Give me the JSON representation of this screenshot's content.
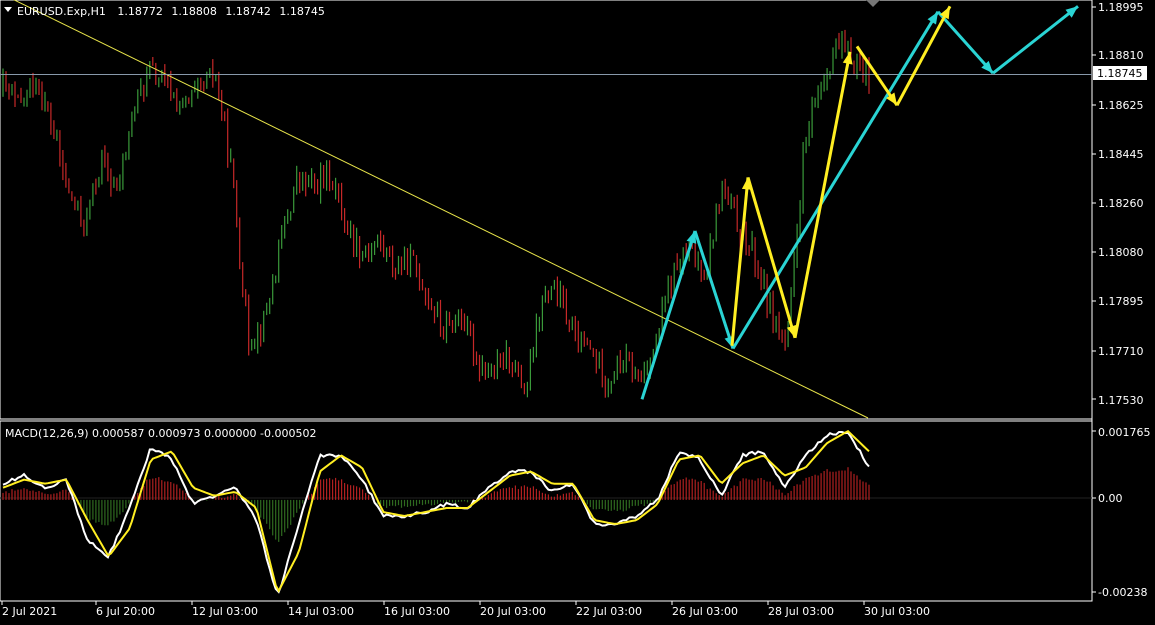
{
  "header": {
    "symbol_line": "EURUSD.Exp,H1",
    "ohlc": [
      "1.18772",
      "1.18808",
      "1.18742",
      "1.18745"
    ]
  },
  "price_axis": {
    "ticks": [
      "1.18995",
      "1.18810",
      "1.18625",
      "1.18445",
      "1.18260",
      "1.18080",
      "1.17895",
      "1.17710",
      "1.17530"
    ],
    "current_price": "1.18745"
  },
  "macd": {
    "title": "MACD(12,26,9) 0.000587 0.000973 0.000000 -0.000502",
    "ticks": [
      "0.001765",
      "0.00",
      "-0.00238"
    ]
  },
  "time_axis": {
    "ticks": [
      "2 Jul 2021",
      "6 Jul 20:00",
      "12 Jul 03:00",
      "14 Jul 03:00",
      "16 Jul 03:00",
      "20 Jul 03:00",
      "22 Jul 03:00",
      "26 Jul 03:00",
      "28 Jul 03:00",
      "30 Jul 03:00"
    ]
  },
  "colors": {
    "background": "#000000",
    "bull_candle": "#3a9a3a",
    "bear_candle": "#c62828",
    "trendline": "#e8e44a",
    "yellow_arrows": "#ffee22",
    "cyan_arrows": "#2ad4d4",
    "macd_line": "#ffffff",
    "signal_line": "#ffee22",
    "hist_positive": "#b02020",
    "hist_negative": "#2f6a1f",
    "current_price_line": "#8899aa"
  },
  "chart_data": [
    {
      "type": "candlestick",
      "symbol": "EURUSD.Exp",
      "timeframe": "H1",
      "ylim": [
        1.1746,
        1.1902
      ],
      "x_ticks": [
        "2 Jul 2021",
        "6 Jul 20:00",
        "12 Jul 03:00",
        "14 Jul 03:00",
        "16 Jul 03:00",
        "20 Jul 03:00",
        "22 Jul 03:00",
        "26 Jul 03:00",
        "28 Jul 03:00",
        "30 Jul 03:00"
      ],
      "close_path": [
        1.187,
        1.1862,
        1.1873,
        1.1855,
        1.183,
        1.1818,
        1.1842,
        1.183,
        1.1862,
        1.1876,
        1.187,
        1.1862,
        1.1868,
        1.1875,
        1.1838,
        1.1775,
        1.1782,
        1.1812,
        1.1835,
        1.1832,
        1.1838,
        1.1818,
        1.1808,
        1.1812,
        1.1802,
        1.1805,
        1.1792,
        1.1778,
        1.1785,
        1.1768,
        1.1762,
        1.177,
        1.1755,
        1.179,
        1.1793,
        1.1775,
        1.1771,
        1.176,
        1.1768,
        1.176,
        1.1775,
        1.18,
        1.1808,
        1.1801,
        1.1832,
        1.1818,
        1.1806,
        1.1786,
        1.1772,
        1.1845,
        1.187,
        1.1885,
        1.188,
        1.1875
      ],
      "trendline": [
        [
          0,
          1.1905
        ],
        [
          868,
          1.1746
        ]
      ],
      "current_price": 1.18745,
      "arrows_yellow": [
        [
          [
            732,
            1.1773
          ],
          [
            748,
            1.1836
          ]
        ],
        [
          [
            748,
            1.1836
          ],
          [
            795,
            1.1776
          ]
        ],
        [
          [
            795,
            1.1776
          ],
          [
            850,
            1.1883
          ]
        ],
        [
          [
            857,
            1.1885
          ],
          [
            897,
            1.1863
          ]
        ],
        [
          [
            897,
            1.1863
          ],
          [
            950,
            1.19
          ]
        ]
      ],
      "arrows_cyan": [
        [
          [
            642,
            1.1753
          ],
          [
            695,
            1.1816
          ]
        ],
        [
          [
            695,
            1.1816
          ],
          [
            733,
            1.1772
          ]
        ],
        [
          [
            733,
            1.1772
          ],
          [
            938,
            1.1898
          ]
        ],
        [
          [
            938,
            1.1898
          ],
          [
            993,
            1.1875
          ]
        ],
        [
          [
            993,
            1.1875
          ],
          [
            1078,
            1.19
          ]
        ]
      ]
    },
    {
      "type": "macd",
      "params": [
        12,
        26,
        9
      ],
      "values": {
        "macd": 0.000587,
        "signal": 0.000973,
        "third": 0.0,
        "fourth": -0.000502
      },
      "ylim": [
        -0.00245,
        0.0019
      ],
      "y_ticks": [
        0.001765,
        0.0,
        -0.00238
      ],
      "macd_line_path": [
        0.0004,
        0.0006,
        0.0003,
        0.0005,
        -0.001,
        -0.0014,
        -0.0002,
        0.0013,
        0.001,
        -0.0001,
        0.0001,
        0.0003,
        -0.0005,
        -0.0024,
        -0.0006,
        0.0011,
        0.0011,
        0.0005,
        -0.0004,
        -0.0004,
        -0.0003,
        -0.0001,
        -0.0002,
        0.0003,
        0.0007,
        0.0007,
        0.0002,
        0.0004,
        -0.0006,
        -0.0006,
        -0.0004,
        0.0,
        0.0012,
        0.001,
        0.0001,
        0.0011,
        0.0012,
        0.0003,
        0.0011,
        0.0016,
        0.0017,
        0.0008
      ],
      "signal_line_path": [
        0.0003,
        0.0005,
        0.0004,
        0.0005,
        -0.0005,
        -0.0014,
        -0.0007,
        0.001,
        0.0012,
        0.0003,
        0.0001,
        0.0002,
        -0.0002,
        -0.0023,
        -0.0013,
        0.0007,
        0.0011,
        0.0008,
        -0.0003,
        -0.0004,
        -0.0003,
        -0.0002,
        -0.0002,
        0.0002,
        0.0006,
        0.0007,
        0.0004,
        0.0004,
        -0.0005,
        -0.0006,
        -0.0005,
        -0.0001,
        0.001,
        0.0011,
        0.0004,
        0.0009,
        0.0011,
        0.0006,
        0.0008,
        0.0014,
        0.0017,
        0.0012
      ]
    }
  ]
}
